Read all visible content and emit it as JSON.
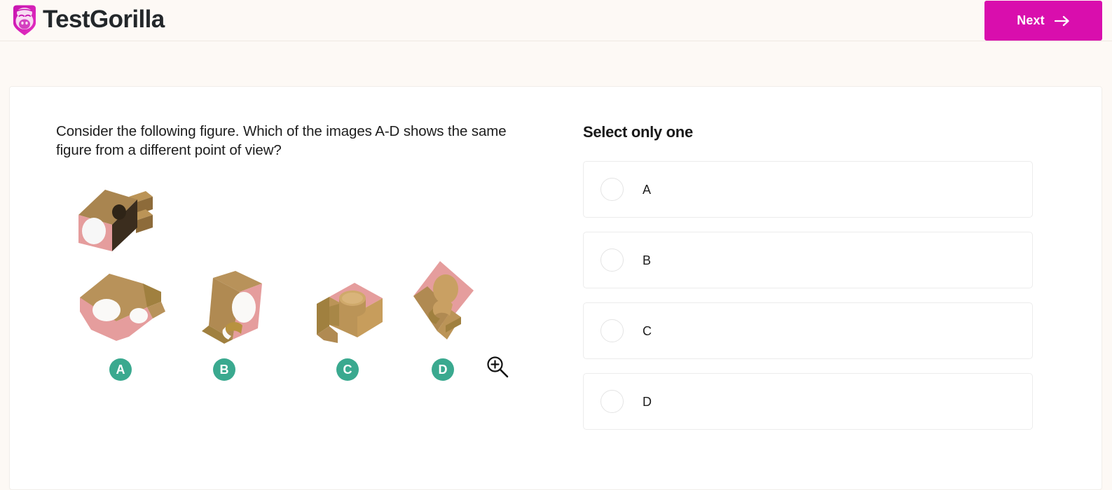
{
  "header": {
    "brand_name": "TestGorilla",
    "logo_icon": "gorilla-logo-icon",
    "next_label": "Next",
    "next_arrow_icon": "arrow-right-icon",
    "accent_color": "#d90ead",
    "background_color": "#fdf9f5"
  },
  "question": {
    "text": "Consider the following figure. Which of the images A-D shows the same figure from a different point of view?",
    "zoom_icon": "zoom-in-magnifier-icon"
  },
  "figures": {
    "badge_color": "#3aa98f",
    "prompt_figure": {
      "name": "prompt-figure",
      "description": "3D block with large circular hole, pink front face and tan cut faces"
    },
    "choices": [
      {
        "badge": "A",
        "name": "figure-a",
        "description": "block rotated, two circular holes visible on pink top face"
      },
      {
        "badge": "B",
        "name": "figure-b",
        "description": "block tilted, pink face with oval hole and notch"
      },
      {
        "badge": "C",
        "name": "figure-c",
        "description": "block seen from above, tan sides with pink top face and circular bore"
      },
      {
        "badge": "D",
        "name": "figure-d",
        "description": "block rotated diamond orientation, pink face with hole and slot"
      }
    ]
  },
  "answers": {
    "title": "Select only one",
    "options": [
      {
        "label": "A",
        "selected": false
      },
      {
        "label": "B",
        "selected": false
      },
      {
        "label": "C",
        "selected": false
      },
      {
        "label": "D",
        "selected": false
      }
    ]
  },
  "colors": {
    "figure_pink": "#e8a0a0",
    "figure_tan": "#c9a063",
    "figure_tan_dark": "#a8884f",
    "card_background": "#ffffff"
  }
}
